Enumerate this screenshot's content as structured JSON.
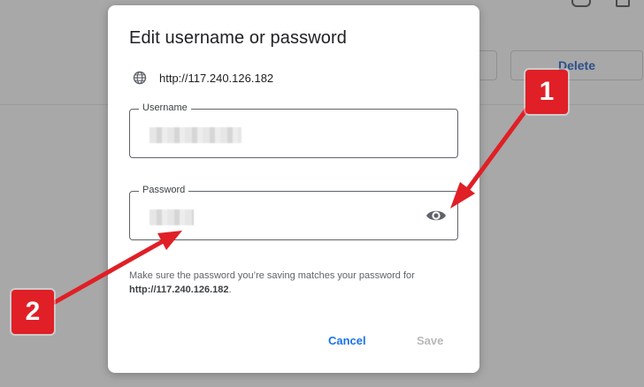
{
  "background": {
    "delete_label": "Delete"
  },
  "dialog": {
    "title": "Edit username or password",
    "site_url": "http://117.240.126.182",
    "username_label": "Username",
    "password_label": "Password",
    "hint_text": "Make sure the password you’re saving matches your password for ",
    "hint_link": "http://117.240.126.182",
    "hint_end": ".",
    "cancel_label": "Cancel",
    "save_label": "Save"
  },
  "annotations": {
    "badge_one": "1",
    "badge_two": "2",
    "color": "#e01f26"
  },
  "colors": {
    "accent": "#1a73e8",
    "disabled": "#b8b8b8"
  }
}
